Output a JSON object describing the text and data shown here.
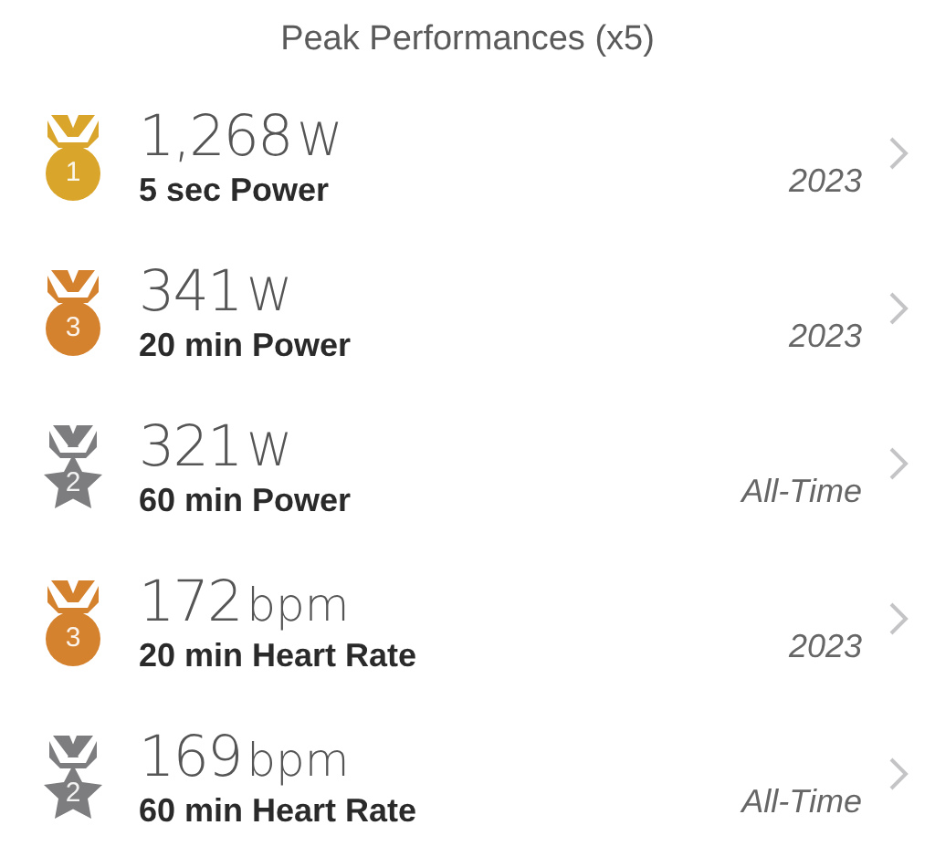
{
  "title": "Peak Performances (x5)",
  "records": [
    {
      "badge": {
        "kind": "medal",
        "color": "#d9a52a",
        "rank": "1"
      },
      "value": "1,268",
      "unit": "W",
      "label": "5 sec Power",
      "period": "2023"
    },
    {
      "badge": {
        "kind": "medal",
        "color": "#d5822f",
        "rank": "3"
      },
      "value": "341",
      "unit": "W",
      "label": "20 min Power",
      "period": "2023"
    },
    {
      "badge": {
        "kind": "star",
        "color": "#7d7d7f",
        "rank": "2"
      },
      "value": "321",
      "unit": "W",
      "label": "60 min Power",
      "period": "All-Time"
    },
    {
      "badge": {
        "kind": "medal",
        "color": "#d5822f",
        "rank": "3"
      },
      "value": "172",
      "unit": "bpm",
      "label": "20 min Heart Rate",
      "period": "2023"
    },
    {
      "badge": {
        "kind": "star",
        "color": "#7d7d7f",
        "rank": "2"
      },
      "value": "169",
      "unit": "bpm",
      "label": "60 min Heart Rate",
      "period": "All-Time"
    }
  ]
}
